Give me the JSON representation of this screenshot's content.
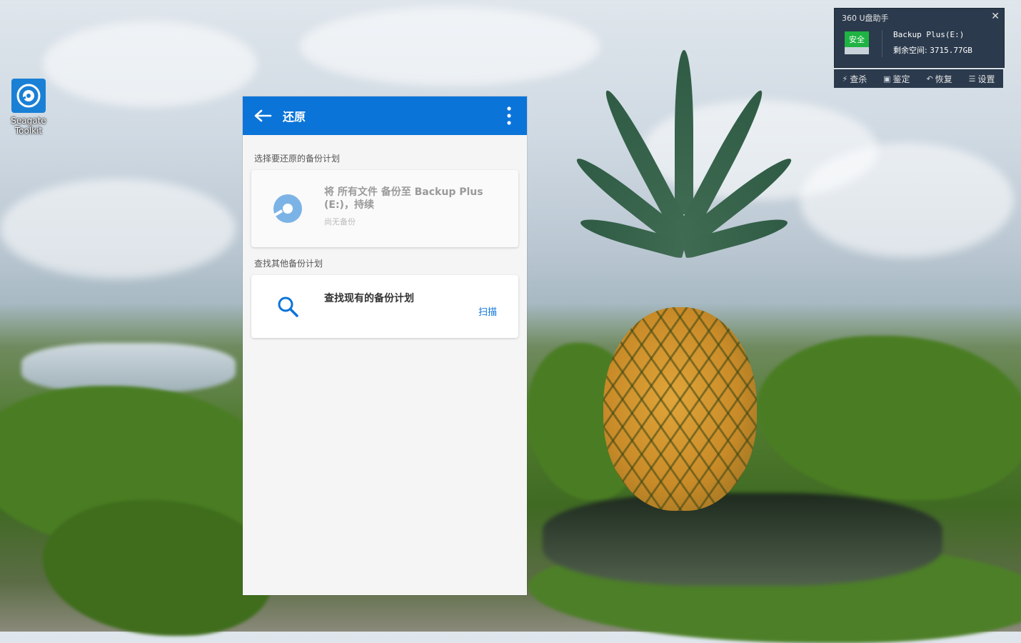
{
  "desktop": {
    "icon_label": "Seagate Toolkit"
  },
  "app": {
    "title": "还原",
    "section_restore_label": "选择要还原的备份计划",
    "plan": {
      "title": "将 所有文件 备份至 Backup Plus (E:)，持续",
      "subtitle": "尚无备份"
    },
    "section_find_label": "查找其他备份计划",
    "find": {
      "title": "查找现有的备份计划",
      "action": "扫描"
    },
    "colors": {
      "accent": "#0b74d9"
    }
  },
  "widget": {
    "title": "360 U盘助手",
    "status": "安全",
    "drive_name": "Backup Plus(E:)",
    "free_label": "剩余空间:",
    "free_value": "3715.77GB",
    "actions": [
      "查杀",
      "鉴定",
      "恢复",
      "设置"
    ]
  }
}
